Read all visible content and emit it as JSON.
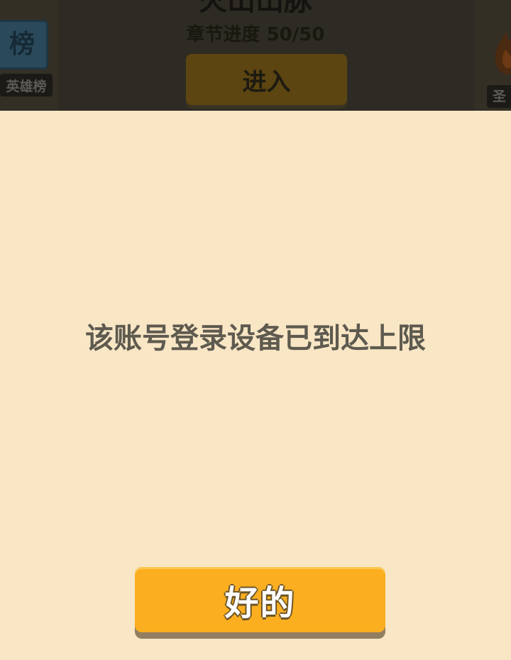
{
  "background": {
    "hero_board": {
      "icon": "ranking-board-icon",
      "icon_glyph": "榜",
      "label": "英雄榜"
    },
    "chapter": {
      "title": "火山山脉",
      "progress": "章节进度 50/50",
      "enter_label": "进入"
    },
    "right_panel": {
      "icon": "flame-icon",
      "label": "圣"
    }
  },
  "dialog": {
    "message": "该账号登录设备已到达上限",
    "ok_label": "好的"
  },
  "colors": {
    "dialog_bg": "#f8e6c5",
    "message_text": "#5e5a4f",
    "button_fill": "#fbae1f",
    "button_shadow": "#927f62"
  }
}
